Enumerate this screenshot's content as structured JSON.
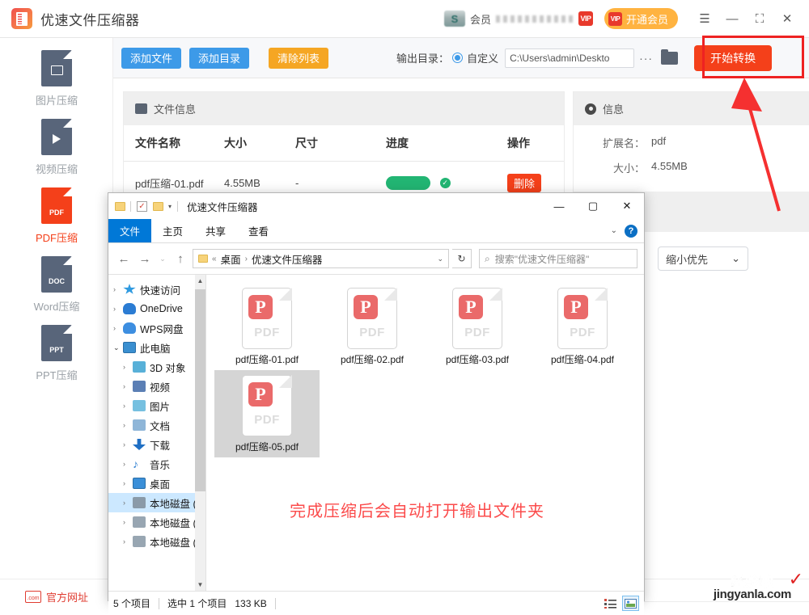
{
  "app": {
    "title": "优速文件压缩器",
    "logo_icon": "compressor-app-icon",
    "member_label": "会员",
    "vip_chip": "VIP",
    "vip_button": "开通会员",
    "window_controls": {
      "menu": "☰",
      "minimize": "—",
      "maximize": "⛶",
      "close": "✕"
    }
  },
  "toolbar": {
    "add_file": "添加文件",
    "add_folder": "添加目录",
    "clear_list": "清除列表",
    "output_label": "输出目录：",
    "custom_radio": "自定义",
    "path_value": "C:\\Users\\admin\\Deskto",
    "more_dots": "···",
    "folder_icon": "folder-icon",
    "start_button": "开始转换"
  },
  "sidebar": {
    "items": [
      {
        "label": "图片压缩",
        "icon": "image-file-icon",
        "active": false
      },
      {
        "label": "视频压缩",
        "icon": "video-file-icon",
        "active": false
      },
      {
        "label": "PDF压缩",
        "icon": "pdf-file-icon",
        "active": true
      },
      {
        "label": "Word压缩",
        "icon": "doc-file-icon",
        "active": false
      },
      {
        "label": "PPT压缩",
        "icon": "ppt-file-icon",
        "active": false
      }
    ],
    "official_site": "官方网址",
    "official_icon": "com-globe-icon"
  },
  "file_panel": {
    "header": "文件信息",
    "header_icon": "picture-icon",
    "columns": [
      "文件名称",
      "大小",
      "尺寸",
      "进度",
      "操作"
    ],
    "rows": [
      {
        "name": "pdf压缩-01.pdf",
        "size": "4.55MB",
        "dimension": "-",
        "progress_percent": 100,
        "progress_done_icon": "check-circle-icon",
        "action": "删除"
      }
    ]
  },
  "info_panel": {
    "header": "信息",
    "header_icon": "gear-icon",
    "fields": [
      {
        "key": "扩展名：",
        "value": "pdf"
      },
      {
        "key": "大小：",
        "value": "4.55MB"
      }
    ],
    "mode_select": {
      "value": "缩小优先",
      "caret": "⌄"
    }
  },
  "explorer": {
    "title": "优速文件压缩器",
    "quick_access_icons": [
      "folder-icon",
      "checkbox-icon",
      "folder-icon",
      "caret-down-icon"
    ],
    "window_controls": {
      "minimize": "—",
      "maximize": "▢",
      "close": "✕"
    },
    "ribbon_tabs": [
      {
        "label": "文件",
        "active": true
      },
      {
        "label": "主页",
        "active": false
      },
      {
        "label": "共享",
        "active": false
      },
      {
        "label": "查看",
        "active": false
      }
    ],
    "ribbon_caret": "⌄",
    "help_icon": "?",
    "nav": {
      "back": "←",
      "forward": "→",
      "recent": "⌄",
      "up": "↑"
    },
    "breadcrumb": {
      "prefix": "«",
      "parts": [
        "桌面",
        "优速文件压缩器"
      ],
      "separator": "›",
      "caret": "⌄"
    },
    "refresh_icon": "↻",
    "search_placeholder": "搜索\"优速文件压缩器\"",
    "search_icon": "search-icon",
    "tree": [
      {
        "label": "快速访问",
        "indent": 0,
        "expander": "›",
        "icon": "star-icon",
        "color": "#2f9ae0",
        "selected": false
      },
      {
        "label": "OneDrive",
        "indent": 0,
        "expander": "›",
        "icon": "cloud-icon",
        "color": "#2b7cd3",
        "selected": false
      },
      {
        "label": "WPS网盘",
        "indent": 0,
        "expander": "›",
        "icon": "cloud-icon",
        "color": "#3d8ee0",
        "selected": false
      },
      {
        "label": "此电脑",
        "indent": 0,
        "expander": "⌄",
        "icon": "computer-icon",
        "color": "#3a8fd0",
        "selected": false
      },
      {
        "label": "3D 对象",
        "indent": 1,
        "expander": "›",
        "icon": "cube-icon",
        "color": "#58b0d8",
        "selected": false
      },
      {
        "label": "视频",
        "indent": 1,
        "expander": "›",
        "icon": "video-icon",
        "color": "#5b7fb5",
        "selected": false
      },
      {
        "label": "图片",
        "indent": 1,
        "expander": "›",
        "icon": "pictures-icon",
        "color": "#76c0e0",
        "selected": false
      },
      {
        "label": "文档",
        "indent": 1,
        "expander": "›",
        "icon": "documents-icon",
        "color": "#8fb6d8",
        "selected": false
      },
      {
        "label": "下载",
        "indent": 1,
        "expander": "›",
        "icon": "download-icon",
        "color": "#1f6fc4",
        "selected": false
      },
      {
        "label": "音乐",
        "indent": 1,
        "expander": "›",
        "icon": "music-icon",
        "color": "#2f7fd0",
        "selected": false
      },
      {
        "label": "桌面",
        "indent": 1,
        "expander": "›",
        "icon": "desktop-icon",
        "color": "#3b8fd8",
        "selected": false
      },
      {
        "label": "本地磁盘 (C",
        "indent": 1,
        "expander": "›",
        "icon": "system-drive-icon",
        "color": "#8a9aa8",
        "selected": true
      },
      {
        "label": "本地磁盘 (D",
        "indent": 1,
        "expander": "›",
        "icon": "drive-icon",
        "color": "#98a6b2",
        "selected": false
      },
      {
        "label": "本地磁盘 (E",
        "indent": 1,
        "expander": "›",
        "icon": "drive-icon",
        "color": "#98a6b2",
        "selected": false
      }
    ],
    "files": [
      {
        "name": "pdf压缩-01.pdf",
        "type": "PDF",
        "selected": false
      },
      {
        "name": "pdf压缩-02.pdf",
        "type": "PDF",
        "selected": false
      },
      {
        "name": "pdf压缩-03.pdf",
        "type": "PDF",
        "selected": false
      },
      {
        "name": "pdf压缩-04.pdf",
        "type": "PDF",
        "selected": false
      },
      {
        "name": "pdf压缩-05.pdf",
        "type": "PDF",
        "selected": true
      }
    ],
    "status": {
      "count": "5 个项目",
      "selection": "选中 1 个项目",
      "selected_size": "133 KB"
    },
    "view_buttons": [
      {
        "icon": "details-view-icon",
        "active": false
      },
      {
        "icon": "large-icons-view-icon",
        "active": true
      }
    ]
  },
  "annotations": {
    "note_text": "完成压缩后会自动打开输出文件夹",
    "note_color": "#fb4b4b",
    "highlight_color": "#ee2222",
    "arrow_icon": "red-arrow-up-icon"
  },
  "watermark": {
    "line1": "经验啦",
    "line2": "jingyanla.com",
    "check": "✓"
  }
}
